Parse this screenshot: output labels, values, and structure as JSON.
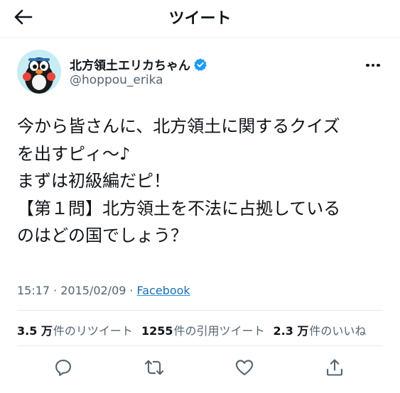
{
  "header": {
    "title": "ツイート"
  },
  "author": {
    "display_name": "北方領土エリカちゃん",
    "username": "@hoppou_erika",
    "verified": true
  },
  "tweet": {
    "text": "今から皆さんに、北方領土に関するクイズ\nを出すピィ〜♪\nまずは初級編だピ！\n【第１問】北方領土を不法に占拠している\nのはどの国でしょう？",
    "time": "15:17",
    "separator": "·",
    "date": "2015/02/09",
    "date_source_sep": "·",
    "source": "Facebook"
  },
  "stats": {
    "retweets_count": "3.5 万",
    "retweets_label": "件のリツイート",
    "quotes_count": "1255",
    "quotes_label": "件の引用ツイート",
    "likes_count": "2.3 万",
    "likes_label": "件のいいね"
  },
  "colors": {
    "accent": "#1d9bf0",
    "text": "#0f1419",
    "secondary": "#536471",
    "divider": "#e6e9eb"
  },
  "icons": {
    "back": "arrow-left-icon",
    "verified": "verified-badge-icon",
    "more": "more-horizontal-icon",
    "reply": "reply-icon",
    "retweet": "retweet-icon",
    "like": "heart-icon",
    "share": "share-icon"
  }
}
